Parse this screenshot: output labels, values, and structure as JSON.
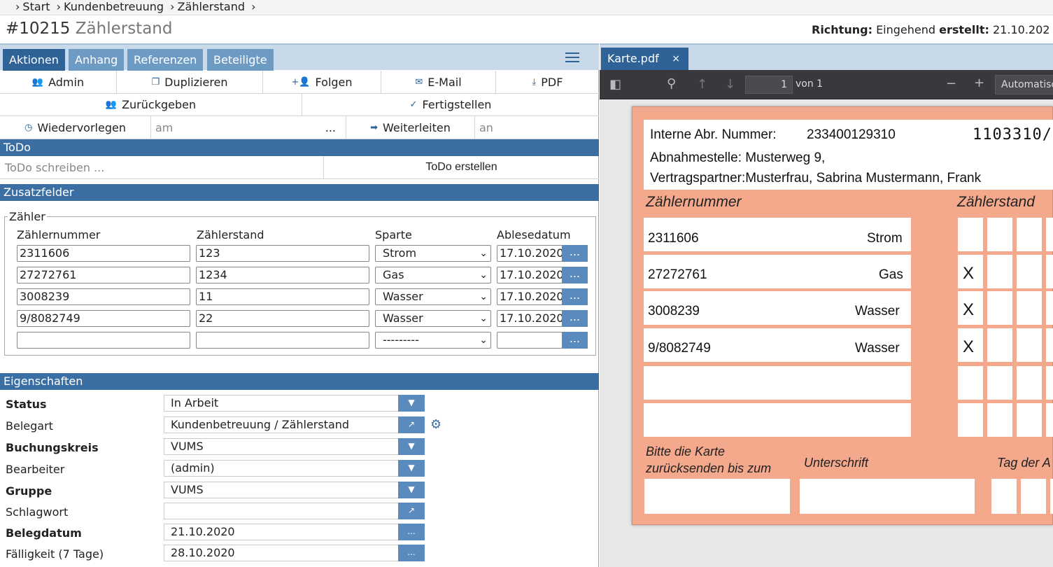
{
  "breadcrumb": {
    "items": [
      "Start",
      "Kundenbetreuung",
      "Zählerstand"
    ]
  },
  "header": {
    "number": "#10215",
    "name": "Zählerstand",
    "richtung_label": "Richtung:",
    "richtung_value": "Eingehend",
    "erstellt_label": "erstellt:",
    "erstellt_value": "21.10.202"
  },
  "tabs": [
    "Aktionen",
    "Anhang",
    "Referenzen",
    "Beteiligte"
  ],
  "actions": {
    "row1": [
      "Admin",
      "Duplizieren",
      "Folgen",
      "E-Mail",
      "PDF"
    ],
    "row2": [
      "Zurückgeben",
      "Fertigstellen"
    ],
    "wiedervorlegen": "Wiedervorlegen",
    "am_placeholder": "am",
    "dots": "...",
    "weiterleiten": "Weiterleiten",
    "an_placeholder": "an"
  },
  "todo": {
    "header": "ToDo",
    "placeholder": "ToDo schreiben ...",
    "button": "ToDo erstellen"
  },
  "zusatzfelder": {
    "header": "Zusatzfelder",
    "legend": "Zähler",
    "columns": [
      "Zählernummer",
      "Zählerstand",
      "Sparte",
      "Ablesedatum"
    ],
    "rows": [
      {
        "nummer": "2311606",
        "stand": "123",
        "sparte": "Strom",
        "datum": "17.10.2020"
      },
      {
        "nummer": "27272761",
        "stand": "1234",
        "sparte": "Gas",
        "datum": "17.10.2020"
      },
      {
        "nummer": "3008239",
        "stand": "11",
        "sparte": "Wasser",
        "datum": "17.10.2020"
      },
      {
        "nummer": "9/8082749",
        "stand": "22",
        "sparte": "Wasser",
        "datum": "17.10.2020"
      },
      {
        "nummer": "",
        "stand": "",
        "sparte": "---------",
        "datum": ""
      }
    ],
    "picker_label": "..."
  },
  "eigenschaften": {
    "header": "Eigenschaften",
    "rows": [
      {
        "label": "Status",
        "value": "In Arbeit",
        "bold": true,
        "btn": "▼"
      },
      {
        "label": "Belegart",
        "value": "Kundenbetreuung / Zählerstand",
        "bold": false,
        "btn": "↗"
      },
      {
        "label": "Buchungskreis",
        "value": "VUMS",
        "bold": true,
        "btn": "▼"
      },
      {
        "label": "Bearbeiter",
        "value": "(admin)",
        "bold": false,
        "btn": "▼"
      },
      {
        "label": "Gruppe",
        "value": "VUMS",
        "bold": true,
        "btn": "▼"
      },
      {
        "label": "Schlagwort",
        "value": "",
        "bold": false,
        "btn": "↗"
      },
      {
        "label": "Belegdatum",
        "value": "21.10.2020",
        "bold": true,
        "btn": "..."
      },
      {
        "label": "Fälligkeit (7 Tage)",
        "value": "28.10.2020",
        "bold": false,
        "btn": "..."
      }
    ]
  },
  "viewer": {
    "tab_label": "Karte.pdf",
    "close": "×",
    "page": "1",
    "page_of": "von 1",
    "zoom": "Automatisch"
  },
  "card": {
    "abr_label": "Interne Abr. Nummer:",
    "abr_value": "233400129310",
    "code": "1103310/",
    "abnahme": "Abnahmestelle: Musterweg 9,",
    "vertrag": "Vertragspartner:Musterfrau, Sabrina Mustermann, Frank",
    "col1": "Zählernummer",
    "col2": "Zählerstand",
    "rows": [
      {
        "num": "2311606",
        "type": "Strom",
        "mark": ""
      },
      {
        "num": "27272761",
        "type": "Gas",
        "mark": "X"
      },
      {
        "num": "3008239",
        "type": "Wasser",
        "mark": "X"
      },
      {
        "num": "9/8082749",
        "type": "Wasser",
        "mark": "X"
      }
    ],
    "bitte1": "Bitte die Karte",
    "bitte2": "zurücksenden bis zum",
    "unterschrift": "Unterschrift",
    "tag": "Tag der A"
  }
}
